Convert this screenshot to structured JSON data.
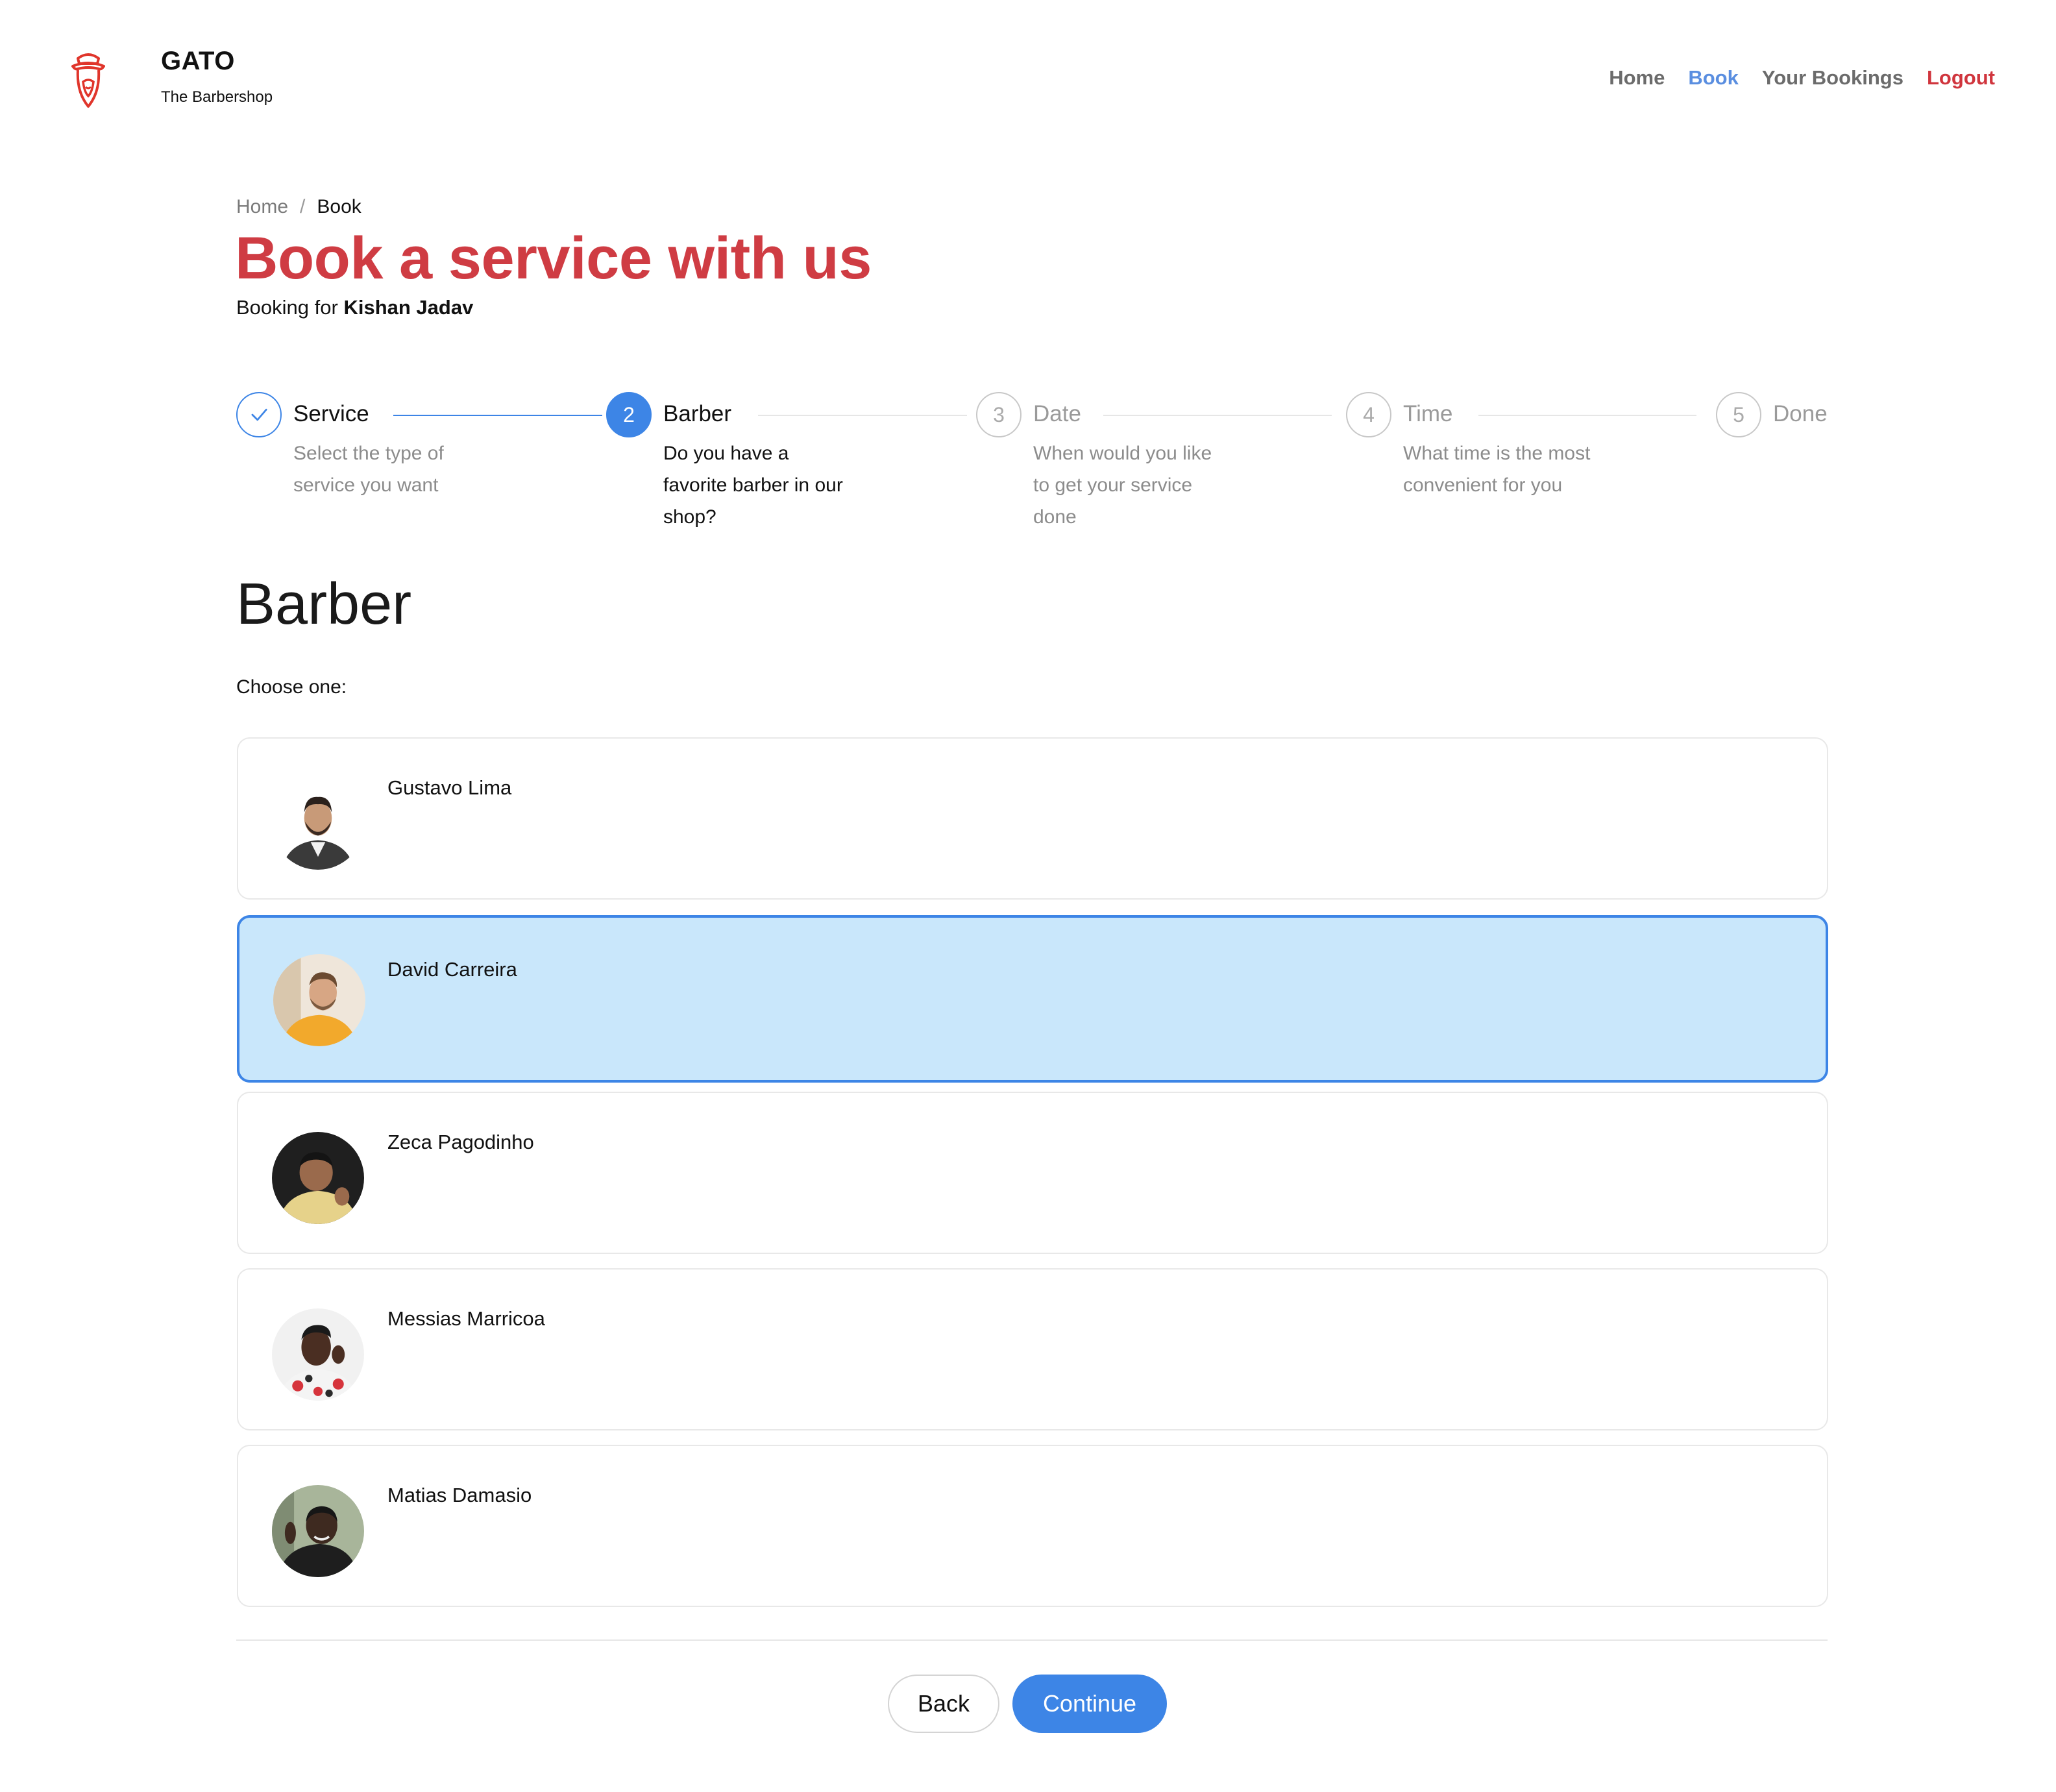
{
  "header": {
    "brand_name": "GATO",
    "brand_tagline": "The Barbershop",
    "logo_icon": "barber-mascot-icon",
    "nav": {
      "home": "Home",
      "book": "Book",
      "bookings": "Your Bookings",
      "logout": "Logout"
    }
  },
  "breadcrumb": {
    "home": "Home",
    "separator": "/",
    "current": "Book"
  },
  "page": {
    "title": "Book a service with us",
    "booking_for_prefix": "Booking for",
    "customer_name": "Kishan Jadav"
  },
  "steps": [
    {
      "number": "",
      "title": "Service",
      "description": "Select the type of service you want",
      "status": "completed",
      "icon": "check-icon"
    },
    {
      "number": "2",
      "title": "Barber",
      "description": "Do you have a favorite barber in our shop?",
      "status": "current"
    },
    {
      "number": "3",
      "title": "Date",
      "description": "When would you like to get your service done",
      "status": "pending"
    },
    {
      "number": "4",
      "title": "Time",
      "description": "What time is the most convenient for you",
      "status": "pending"
    },
    {
      "number": "5",
      "title": "Done",
      "description": "",
      "status": "pending"
    }
  ],
  "barber_section": {
    "title": "Barber",
    "prompt": "Choose one:",
    "barbers": [
      {
        "name": "Gustavo Lima",
        "selected": false
      },
      {
        "name": "David Carreira",
        "selected": true
      },
      {
        "name": "Zeca Pagodinho",
        "selected": false
      },
      {
        "name": "Messias Marricoa",
        "selected": false
      },
      {
        "name": "Matias Damasio",
        "selected": false
      }
    ]
  },
  "actions": {
    "back": "Back",
    "continue": "Continue"
  },
  "colors": {
    "brand_red": "#cf3c43",
    "primary_blue": "#3d85e6",
    "selected_bg": "#c9e7fb",
    "nav_active": "#5a8ee0"
  }
}
